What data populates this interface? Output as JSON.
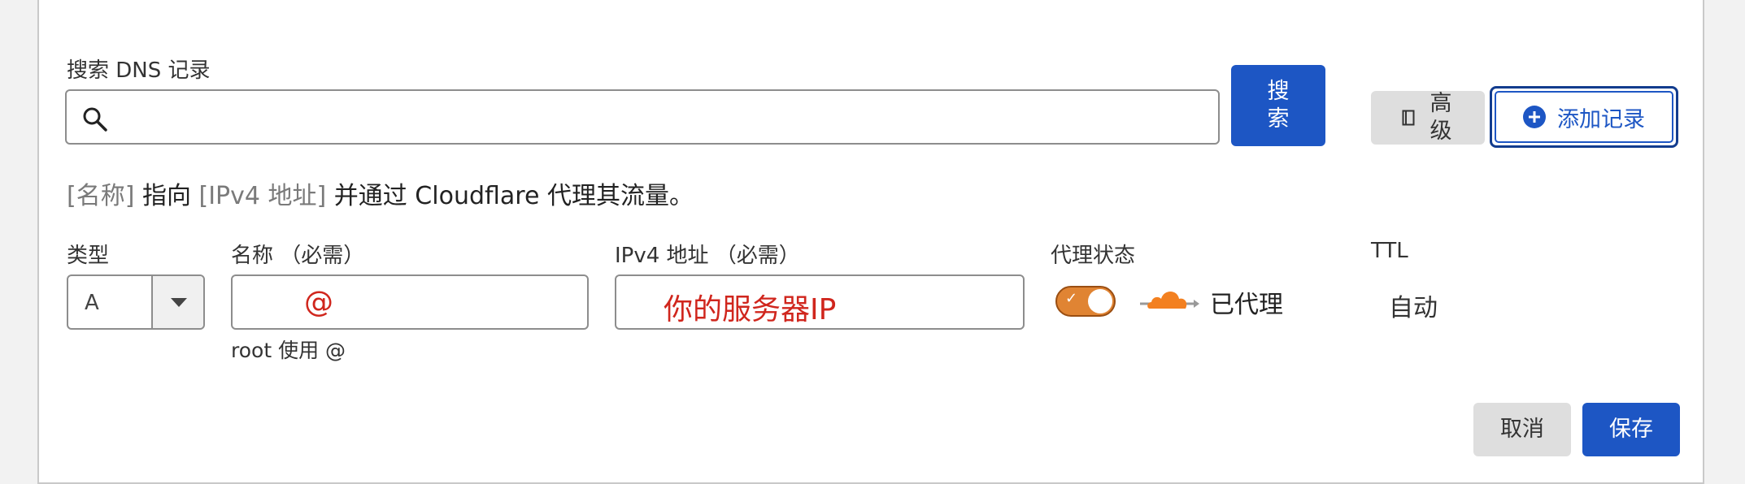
{
  "search": {
    "label": "搜索 DNS 记录",
    "value": "",
    "search_button": "搜索",
    "advanced_button": "高级",
    "add_record_button": "添加记录"
  },
  "description": {
    "name_token": "[名称]",
    "points_to": " 指向 ",
    "ip_token": "[IPv4 地址]",
    "rest": " 并通过 Cloudflare 代理其流量。"
  },
  "form": {
    "type_label": "类型",
    "type_value": "A",
    "name_label": "名称 （必需）",
    "name_value": "@",
    "name_hint": "root 使用 @",
    "ip_label": "IPv4 地址 （必需）",
    "ip_value": "你的服务器IP",
    "proxy_label": "代理状态",
    "proxy_enabled": true,
    "proxy_status_text": "已代理",
    "ttl_label": "TTL",
    "ttl_value": "自动"
  },
  "actions": {
    "cancel": "取消",
    "save": "保存"
  },
  "colors": {
    "primary": "#1d56c4",
    "annotation_red": "#d0261d",
    "proxy_orange": "#e08433",
    "cloud_orange": "#f38020"
  },
  "icons": {
    "search": "search-icon",
    "advanced": "book-icon",
    "add": "plus-circle-icon",
    "dropdown": "chevron-down-icon",
    "proxy": "cloud-icon"
  }
}
